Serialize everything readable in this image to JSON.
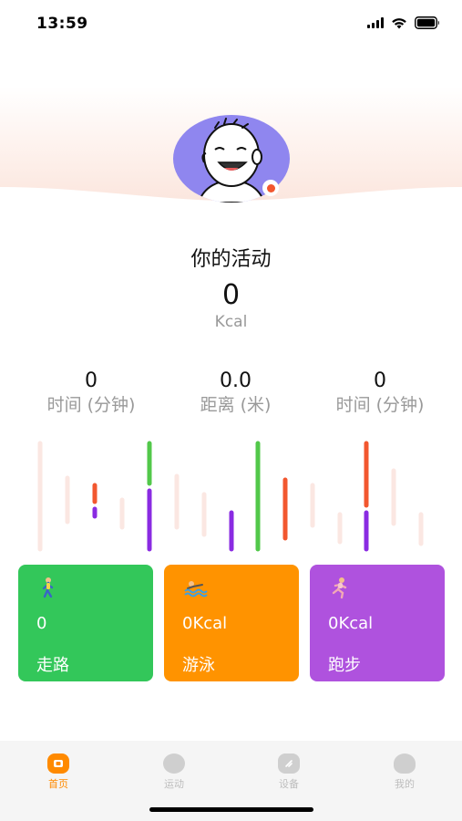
{
  "status_bar": {
    "time": "13:59"
  },
  "profile": {
    "avatar_icon": "cartoon-face-avatar",
    "badge_color": "#f2572f"
  },
  "activity": {
    "title": "你的活动",
    "kcal_value": "0",
    "kcal_unit": "Kcal"
  },
  "stats": [
    {
      "value": "0",
      "label": "时间 (分钟)"
    },
    {
      "value": "0.0",
      "label": "距离 (米)"
    },
    {
      "value": "0",
      "label": "时间 (分钟)"
    }
  ],
  "cards": [
    {
      "icon": "walking-person-icon",
      "value": "0",
      "label": "走路",
      "color": "#33c75a"
    },
    {
      "icon": "swimmer-icon",
      "value": "0Kcal",
      "label": "游泳",
      "color": "#ff9300"
    },
    {
      "icon": "running-person-icon",
      "value": "0Kcal",
      "label": "跑步",
      "color": "#af52de"
    }
  ],
  "tabbar": {
    "items": [
      {
        "label": "首页",
        "icon": "home-icon",
        "active": true
      },
      {
        "label": "运动",
        "icon": "activity-icon",
        "active": false
      },
      {
        "label": "设备",
        "icon": "device-icon",
        "active": false
      },
      {
        "label": "我的",
        "icon": "profile-icon",
        "active": false
      }
    ],
    "active_color": "#ff8a00"
  }
}
